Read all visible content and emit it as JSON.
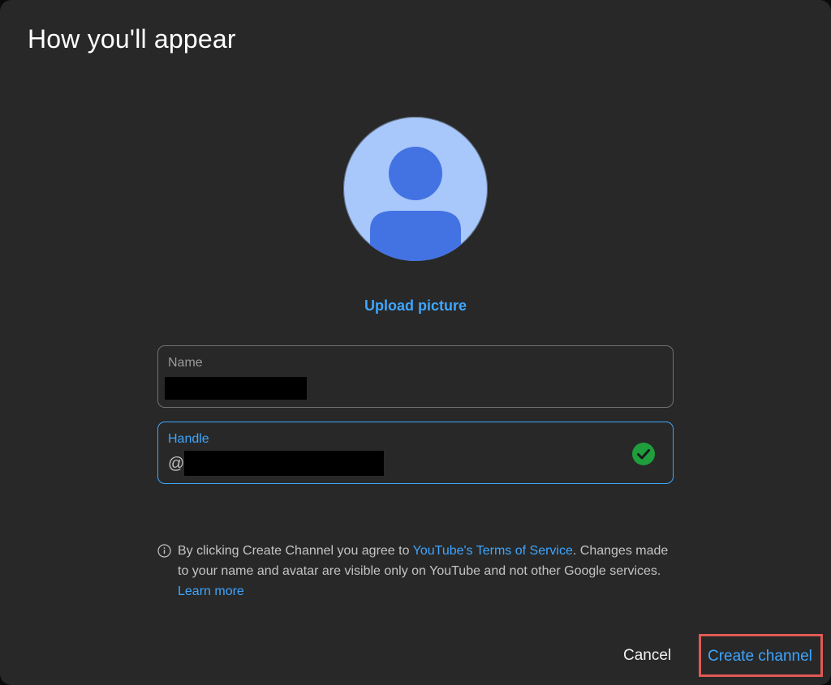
{
  "dialog": {
    "title": "How you'll appear"
  },
  "avatar": {
    "icon": "person-silhouette-icon",
    "bg_color": "#a8c7fa",
    "fg_color": "#4372e3"
  },
  "upload": {
    "label": "Upload picture"
  },
  "name_field": {
    "label": "Name",
    "value_redacted": true
  },
  "handle_field": {
    "label": "Handle",
    "prefix": "@",
    "value_redacted": true,
    "status_icon": "check-circle-icon",
    "status_color": "#1e9e3c"
  },
  "notice": {
    "icon": "info-icon",
    "text_1": "By clicking Create Channel you agree to ",
    "terms_link": "YouTube's Terms of Service",
    "text_2": ". Changes made to your name and avatar are visible only on YouTube and not other Google services. ",
    "learn_more_link": "Learn more"
  },
  "actions": {
    "cancel_label": "Cancel",
    "create_label": "Create channel",
    "highlight_color": "#e05a55",
    "accent_color": "#3ea6ff"
  }
}
